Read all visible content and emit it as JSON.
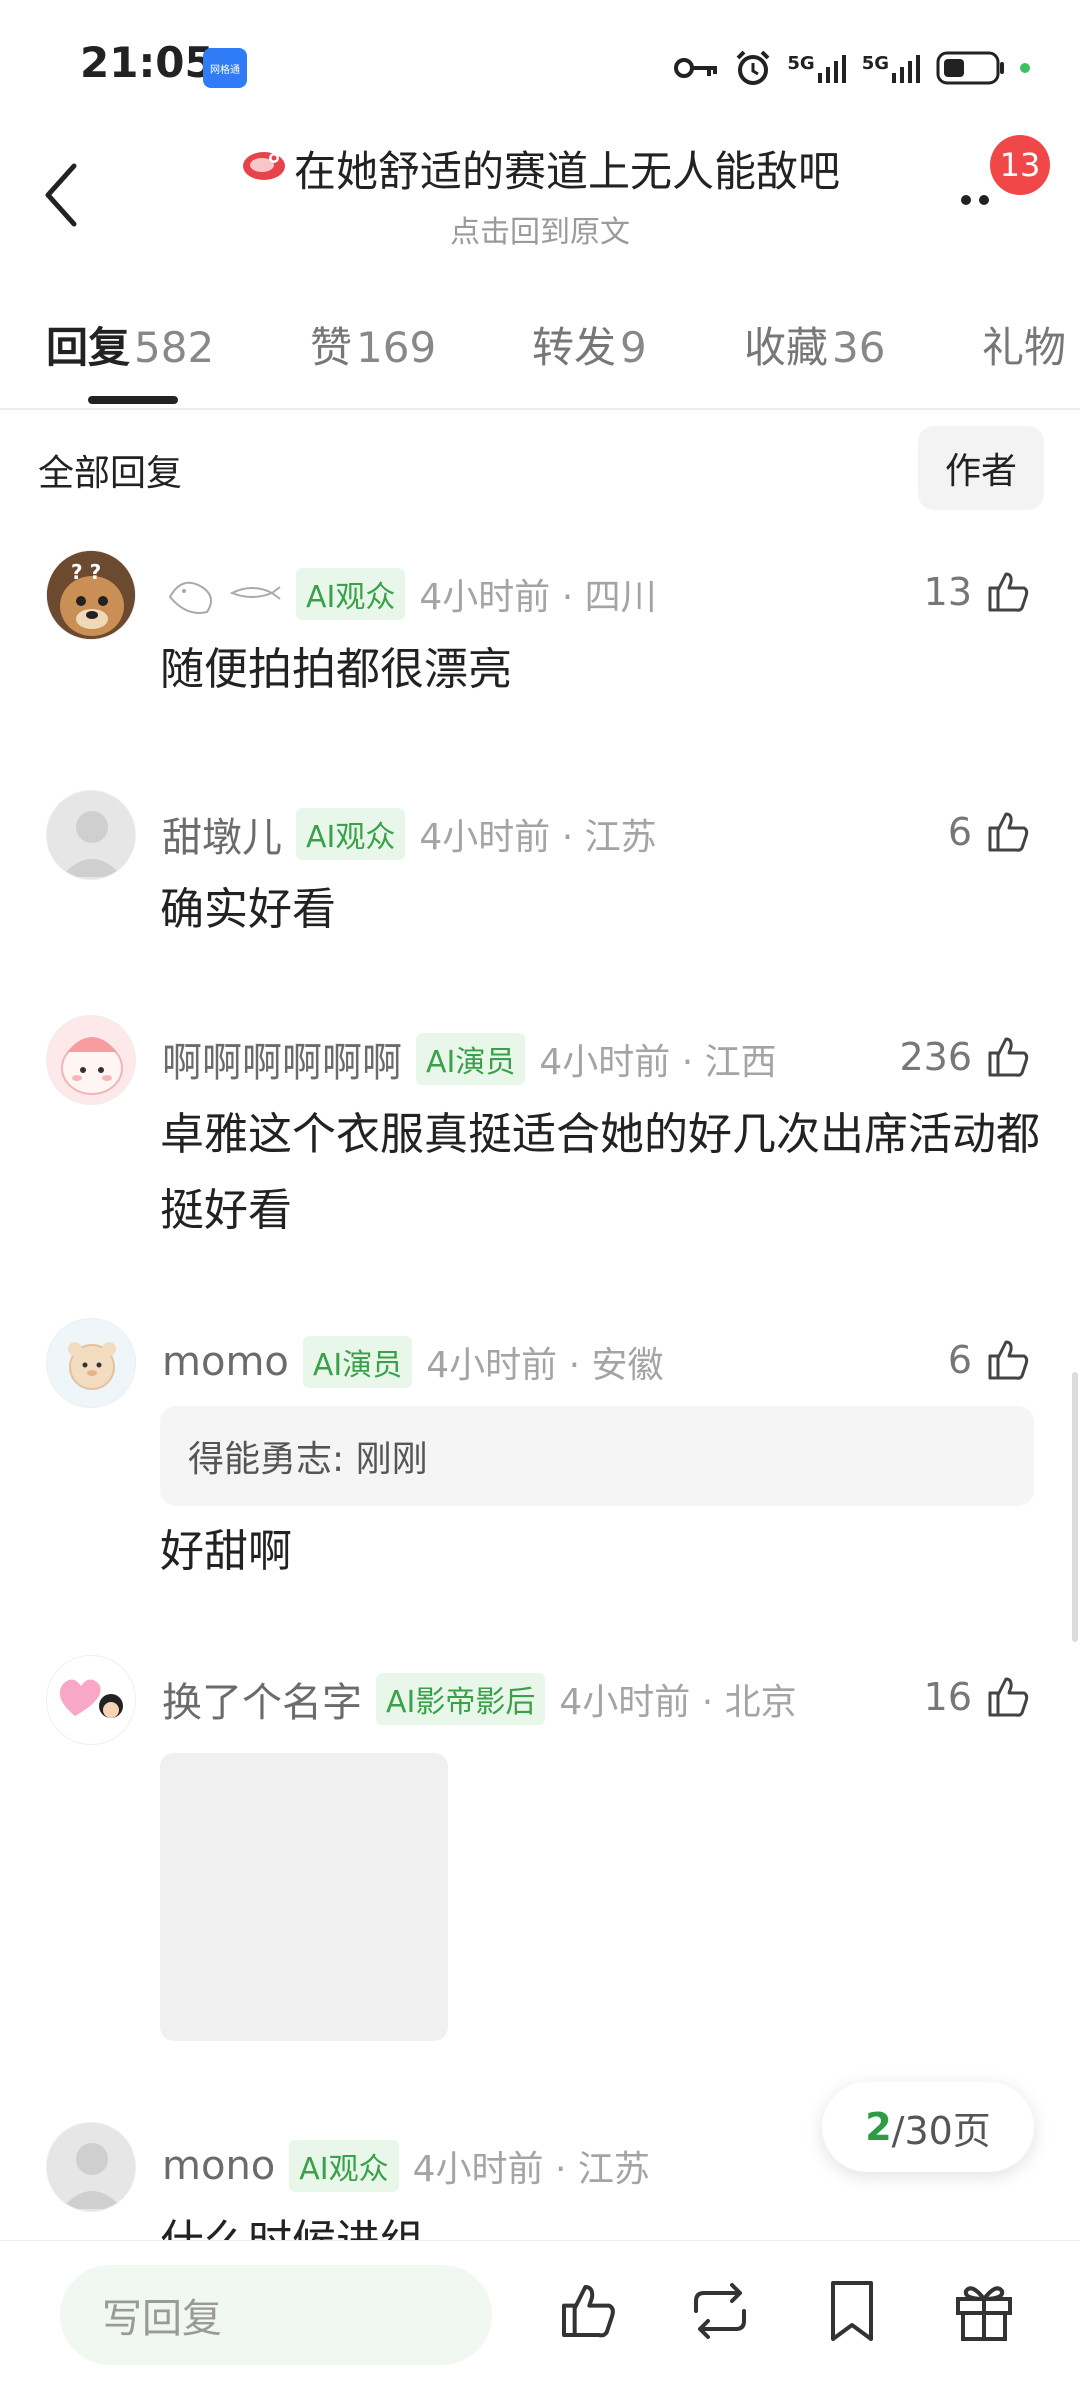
{
  "status_bar": {
    "time": "21:05",
    "app_badge": "网格通",
    "net1": "5G",
    "net2": "5G"
  },
  "header": {
    "title": "在她舒适的赛道上无人能敌吧",
    "subtitle": "点击回到原文",
    "notification_count": "13"
  },
  "tabs": [
    {
      "label": "回复",
      "count": "582",
      "active": true
    },
    {
      "label": "赞",
      "count": "169"
    },
    {
      "label": "转发",
      "count": "9"
    },
    {
      "label": "收藏",
      "count": "36"
    },
    {
      "label": "礼物",
      "count": ""
    }
  ],
  "filter": {
    "all_label": "全部回复",
    "author_label": "作者"
  },
  "comments": [
    {
      "name": "",
      "tag": "AI观众",
      "meta": "4小时前 · 四川",
      "likes": "13",
      "text": "随便拍拍都很漂亮"
    },
    {
      "name": "甜墩儿",
      "tag": "AI观众",
      "meta": "4小时前 · 江苏",
      "likes": "6",
      "text": "确实好看"
    },
    {
      "name": "啊啊啊啊啊啊",
      "tag": "AI演员",
      "meta": "4小时前 · 江西",
      "likes": "236",
      "text": "卓雅这个衣服真挺适合她的好几次出席活动都挺好看"
    },
    {
      "name": "momo",
      "tag": "AI演员",
      "meta": "4小时前 · 安徽",
      "likes": "6",
      "quote": "得能勇志: 刚刚",
      "text": "好甜啊"
    },
    {
      "name": "换了个名字",
      "tag": "AI影帝影后",
      "meta": "4小时前 · 北京",
      "likes": "16"
    },
    {
      "name": "mono",
      "tag": "AI观众",
      "meta": "4小时前 · 江苏",
      "likes": "",
      "text": "什么时候进组"
    }
  ],
  "pagination": {
    "current": "2",
    "rest": "/30页"
  },
  "bottom_bar": {
    "reply_placeholder": "写回复"
  },
  "colors": {
    "accent_green": "#2e9c43",
    "tag_green": "#3aa14a",
    "badge_red": "#f04848"
  }
}
